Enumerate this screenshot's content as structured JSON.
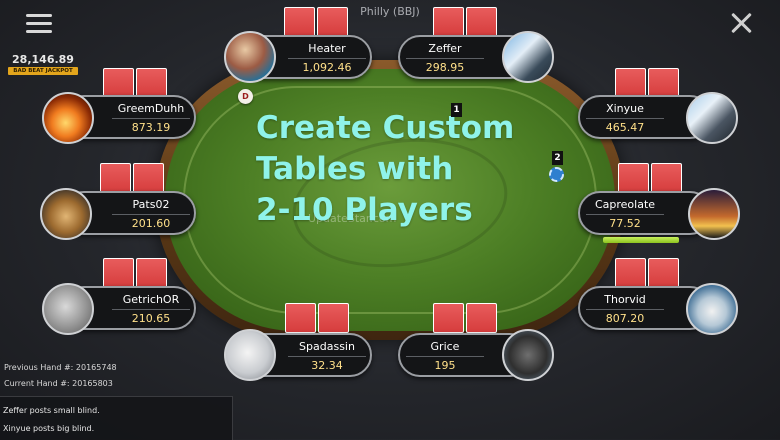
{
  "table_name": "Philly (BBJ)",
  "jackpot": {
    "amount": "28,146.89",
    "label": "BAD BEAT JACKPOT"
  },
  "promo": {
    "line1": "Create Custom",
    "line2": "Tables with",
    "line3": "2-10 Players"
  },
  "watermark": "UpdateStar.com",
  "dealer_button": "D",
  "seat_markers": [
    "1",
    "2"
  ],
  "players": [
    {
      "name": "Heater",
      "chips": "1,092.46",
      "avatar": "city-harbor-photo"
    },
    {
      "name": "Zeffer",
      "chips": "298.95",
      "avatar": "robot-arm-photo"
    },
    {
      "name": "GreemDuhh",
      "chips": "873.19",
      "avatar": "fire-photo"
    },
    {
      "name": "Xinyue",
      "chips": "465.47",
      "avatar": "robot-arm-photo"
    },
    {
      "name": "Pats02",
      "chips": "201.60",
      "avatar": "casino-photo"
    },
    {
      "name": "Capreolate",
      "chips": "77.52",
      "avatar": "las-vegas-photo"
    },
    {
      "name": "GetrichOR",
      "chips": "210.65",
      "avatar": "wolf-photo"
    },
    {
      "name": "Thorvid",
      "chips": "807.20",
      "avatar": "shark-photo"
    },
    {
      "name": "Spadassin",
      "chips": "32.34",
      "avatar": "seahorse-photo"
    },
    {
      "name": "Grice",
      "chips": "195",
      "avatar": "bear-photo"
    }
  ],
  "action_timer_fraction": 1.0,
  "hand_info": {
    "previous": "Previous Hand #: 20165748",
    "current": "Current Hand #: 20165803"
  },
  "log": [
    "Zeffer posts small blind.",
    "Xinyue posts big blind."
  ],
  "colors": {
    "promo_text": "#8ff3ea",
    "chip_text": "#ffe08a",
    "card_back": "#d63d3d",
    "felt": "#4d7f25"
  }
}
